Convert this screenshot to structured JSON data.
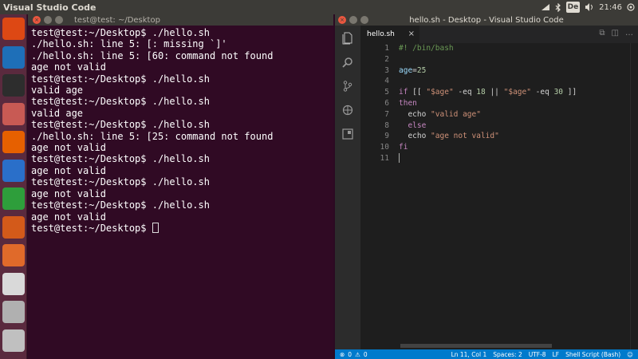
{
  "top_panel": {
    "app_title": "Visual Studio Code",
    "keyboard_layout": "De",
    "clock": "21:46"
  },
  "terminal": {
    "title": "test@test: ~/Desktop",
    "lines": [
      "test@test:~/Desktop$ ./hello.sh",
      "./hello.sh: line 5: [: missing `]'",
      "./hello.sh: line 5: [60: command not found",
      "age not valid",
      "test@test:~/Desktop$ ./hello.sh",
      "valid age",
      "test@test:~/Desktop$ ./hello.sh",
      "valid age",
      "test@test:~/Desktop$ ./hello.sh",
      "./hello.sh: line 5: [25: command not found",
      "age not valid",
      "test@test:~/Desktop$ ./hello.sh",
      "age not valid",
      "test@test:~/Desktop$ ./hello.sh",
      "age not valid",
      "test@test:~/Desktop$ ./hello.sh",
      "age not valid"
    ],
    "prompt": "test@test:~/Desktop$ "
  },
  "vscode": {
    "title": "hello.sh - Desktop - Visual Studio Code",
    "tab_label": "hello.sh",
    "code_lines": [
      [
        {
          "t": "#! /bin/bash",
          "c": "tok-c"
        }
      ],
      [],
      [
        {
          "t": "age",
          "c": "tok-v"
        },
        {
          "t": "=",
          "c": ""
        },
        {
          "t": "25",
          "c": "tok-n"
        }
      ],
      [],
      [
        {
          "t": "if",
          "c": "tok-k"
        },
        {
          "t": " [[ ",
          "c": ""
        },
        {
          "t": "\"$age\"",
          "c": "tok-s"
        },
        {
          "t": " -eq ",
          "c": ""
        },
        {
          "t": "18",
          "c": "tok-n"
        },
        {
          "t": " || ",
          "c": ""
        },
        {
          "t": "\"$age\"",
          "c": "tok-s"
        },
        {
          "t": " -eq ",
          "c": ""
        },
        {
          "t": "30",
          "c": "tok-n"
        },
        {
          "t": " ]]",
          "c": ""
        }
      ],
      [
        {
          "t": "then",
          "c": "tok-k"
        }
      ],
      [
        {
          "t": "  echo ",
          "c": ""
        },
        {
          "t": "\"valid age\"",
          "c": "tok-s"
        }
      ],
      [
        {
          "t": "  else",
          "c": "tok-k"
        }
      ],
      [
        {
          "t": "  echo ",
          "c": ""
        },
        {
          "t": "\"age not valid\"",
          "c": "tok-s"
        }
      ],
      [
        {
          "t": "fi",
          "c": "tok-k"
        }
      ],
      []
    ],
    "status": {
      "errors": "0",
      "warnings": "0",
      "position": "Ln 11, Col 1",
      "indent": "Spaces: 2",
      "encoding": "UTF-8",
      "eol": "LF",
      "language": "Shell Script (Bash)"
    }
  },
  "launcher_items": [
    {
      "icon": "ubuntu-dash-icon",
      "color": "#dd4814"
    },
    {
      "icon": "vscode-icon",
      "color": "#1e6fb8"
    },
    {
      "icon": "terminal-icon",
      "color": "#2d2d2d"
    },
    {
      "icon": "files-icon",
      "color": "#c85a54"
    },
    {
      "icon": "firefox-icon",
      "color": "#e66000"
    },
    {
      "icon": "writer-icon",
      "color": "#2a6fc9"
    },
    {
      "icon": "calc-icon",
      "color": "#2e9e3b"
    },
    {
      "icon": "impress-icon",
      "color": "#d35a1a"
    },
    {
      "icon": "software-center-icon",
      "color": "#e06a2a"
    },
    {
      "icon": "amazon-icon",
      "color": "#d9d9d9"
    },
    {
      "icon": "settings-icon",
      "color": "#b0b0b0"
    },
    {
      "icon": "trash-icon",
      "color": "#c0c0c0"
    }
  ]
}
